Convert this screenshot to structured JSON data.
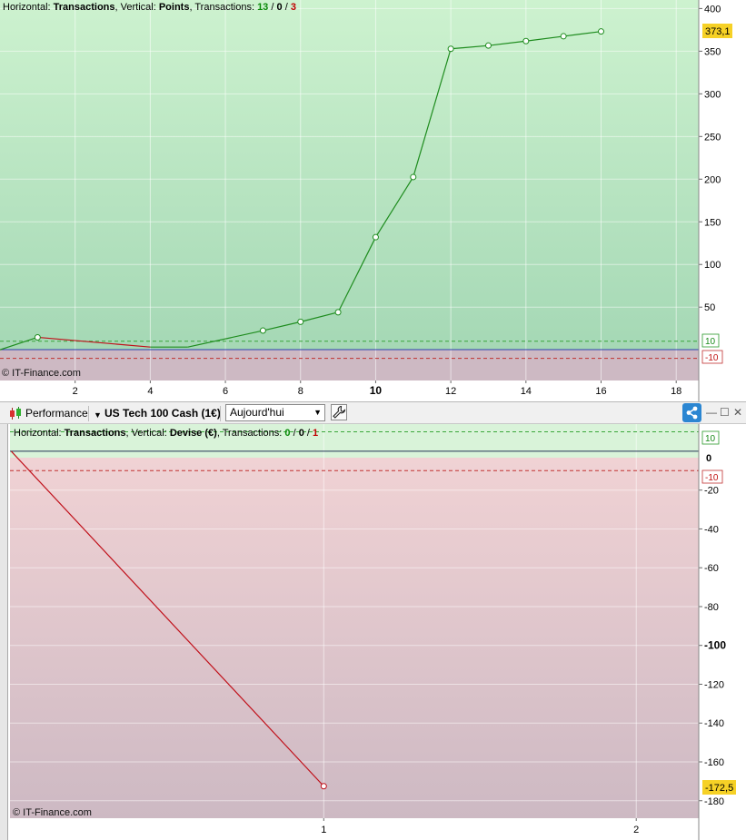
{
  "top_panel": {
    "legend": {
      "horizontal_label": "Horizontal:",
      "horizontal_value": "Transactions",
      "vertical_label": "Vertical:",
      "vertical_value": "Points",
      "transactions_label": "Transactions:",
      "wins": "13",
      "neutral": "0",
      "losses": "3",
      "sep": "/"
    },
    "copyright": "© IT-Finance.com",
    "last_value_badge": "373,1",
    "threshold_pos_label": "10",
    "threshold_neg_label": "-10"
  },
  "toolbar": {
    "indicator_label": "Performance",
    "instrument_label": "US Tech 100 Cash (1€)",
    "period_value": "Aujourd'hui"
  },
  "bottom_panel": {
    "legend": {
      "horizontal_label": "Horizontal:",
      "horizontal_value": "Transactions",
      "vertical_label": "Vertical:",
      "vertical_value": "Devise (€)",
      "transactions_label": "Transactions:",
      "wins": "0",
      "neutral": "0",
      "losses": "1",
      "sep": "/"
    },
    "copyright": "© IT-Finance.com",
    "last_value_badge": "-172,5",
    "threshold_pos_label": "10",
    "threshold_zero_label": "0",
    "threshold_neg_label": "-10"
  },
  "colors": {
    "gain_line": "#1e8c1e",
    "loss_line": "#c0101a",
    "baseline": "#3040b0",
    "badge": "#f6d126",
    "win_text": "#0a8a0a",
    "loss_text": "#c00000"
  },
  "icons": {
    "indicator": "candlestick-icon",
    "instrument_menu": "dropdown-arrow-icon",
    "period_menu": "dropdown-arrow-icon",
    "settings": "wrench-icon",
    "share": "share-icon",
    "minimize": "minimize-icon",
    "restore": "restore-icon",
    "close": "close-icon"
  },
  "chart_data": [
    {
      "type": "line",
      "x": [
        0,
        1,
        4,
        5,
        7,
        8,
        9,
        10,
        11,
        12,
        13,
        14,
        15,
        16
      ],
      "y": [
        0,
        14.6,
        3.2,
        3.2,
        22.5,
        32.8,
        44.0,
        132.0,
        202.5,
        352.8,
        356.6,
        361.8,
        367.5,
        373.1
      ],
      "xlim": [
        0,
        18.6
      ],
      "ylim": [
        -36,
        410
      ],
      "x_ticks": [
        2,
        4,
        6,
        8,
        10,
        12,
        14,
        16,
        18
      ],
      "y_ticks": [
        50,
        100,
        150,
        200,
        250,
        300,
        350,
        400
      ],
      "thresholds": [
        10,
        -10
      ],
      "grid": true
    },
    {
      "type": "line",
      "x": [
        0,
        1
      ],
      "y": [
        0,
        -172.5
      ],
      "xlim": [
        -0.004,
        2.2
      ],
      "ylim": [
        -189,
        14
      ],
      "x_ticks": [
        1,
        2
      ],
      "y_ticks": [
        -20,
        -40,
        -60,
        -80,
        -100,
        -120,
        -140,
        -160,
        -180
      ],
      "thresholds": [
        10,
        0,
        -10
      ],
      "grid": true
    }
  ]
}
